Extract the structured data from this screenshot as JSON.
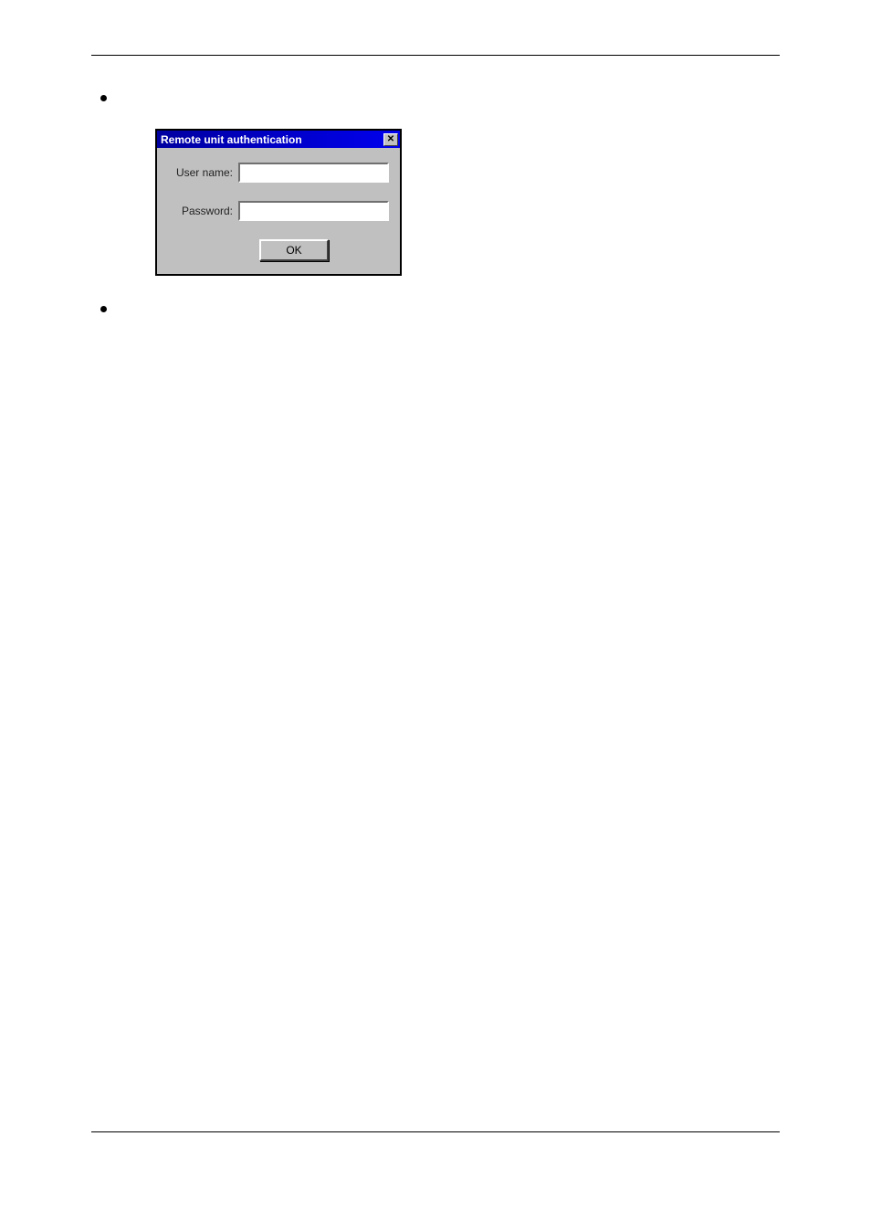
{
  "dialog": {
    "title": "Remote unit authentication",
    "username_label": "User name:",
    "password_label": "Password:",
    "username_value": "",
    "password_value": "",
    "ok_label": "OK"
  }
}
